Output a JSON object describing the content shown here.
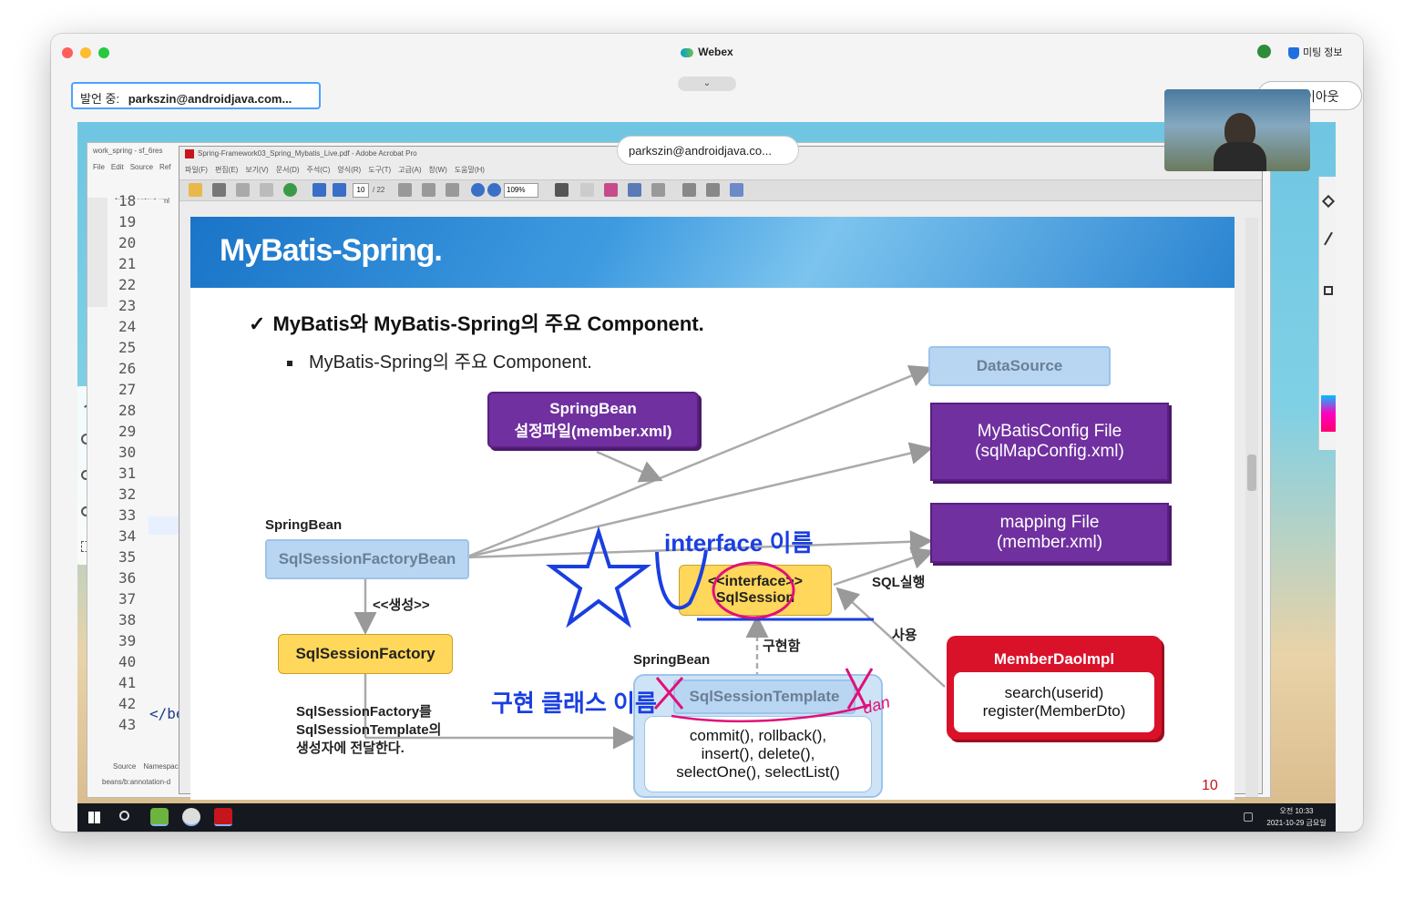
{
  "webex": {
    "app_title": "Webex",
    "meeting_info": "미팅 정보",
    "speaker_prefix": "발언 중:",
    "speaker_name": "parkszin@androidjava.com...",
    "collapse_glyph": "⌄",
    "layout_button": "이아웃",
    "presenter_badge": "parkszin@androidjava.co..."
  },
  "eclipse": {
    "title_tab": "work_spring - sf_6res",
    "menu": [
      "File",
      "Edit",
      "Source",
      "Ref"
    ],
    "editor_tab": "*root-context.xml",
    "line_numbers": [
      "18",
      "19",
      "20",
      "21",
      "22",
      "23",
      "24",
      "25",
      "26",
      "27",
      "28",
      "29",
      "30",
      "31",
      "32",
      "33",
      "34",
      "35",
      "36",
      "37",
      "38",
      "39",
      "40",
      "41",
      "42",
      "43"
    ],
    "line_42_code": "</be",
    "bottom_tabs": [
      "Source",
      "Namespac"
    ],
    "status": "beans/b:annotation-d"
  },
  "acrobat": {
    "title": "Spring-Framework03_Spring_Mybatis_Live.pdf - Adobe Acrobat Pro",
    "menu": [
      "파일(F)",
      "편집(E)",
      "보기(V)",
      "문서(D)",
      "주석(C)",
      "양식(R)",
      "도구(T)",
      "고급(A)",
      "창(W)",
      "도움말(H)"
    ],
    "page_current": "10",
    "page_total": "/ 22",
    "zoom": "109%"
  },
  "slide": {
    "title": "MyBatis-Spring.",
    "heading": "MyBatis와 MyBatis-Spring의 주요 Component.",
    "subheading": "MyBatis-Spring의 주요 Component.",
    "page_number": "10",
    "boxes": {
      "datasource": "DataSource",
      "springbean_config_line1": "SpringBean",
      "springbean_config_line2": "설정파일(member.xml)",
      "mybatis_config_line1": "MyBatisConfig File",
      "mybatis_config_line2": "(sqlMapConfig.xml)",
      "mapping_line1": "mapping File",
      "mapping_line2": "(member.xml)",
      "factorybean": "SqlSessionFactoryBean",
      "factory": "SqlSessionFactory",
      "sqlsession_line1": "<<interface>>",
      "sqlsession_line2": "SqlSession",
      "template": "SqlSessionTemplate",
      "template_methods_line1": "commit(), rollback(),",
      "template_methods_line2": "insert(), delete(),",
      "template_methods_line3": "selectOne(), selectList()",
      "dao_title": "MemberDaoImpl",
      "dao_method1": "search(userid)",
      "dao_method2": "register(MemberDto)"
    },
    "labels": {
      "springbean_1": "SpringBean",
      "springbean_2": "SpringBean",
      "create": "<<생성>>",
      "sql_exec": "SQL실행",
      "use": "사용",
      "implements": "구현함",
      "pass_line1": "SqlSessionFactory를",
      "pass_line2": "SqlSessionTemplate의",
      "pass_line3": "생성자에 전달한다."
    },
    "annotations": {
      "interface_name": "interface 이름",
      "impl_class_name": "구현 클래스 이름",
      "handwritten_note": "dan"
    }
  },
  "taskbar": {
    "time": "오전 10:33",
    "date": "2021-10-29 금요일"
  },
  "colors": {
    "annotation_blue": "#1a3fe0",
    "annotation_pink": "#e0107a",
    "slide_purple": "#7030a0",
    "slide_yellow": "#ffd75a",
    "dao_red": "#d9122a"
  }
}
